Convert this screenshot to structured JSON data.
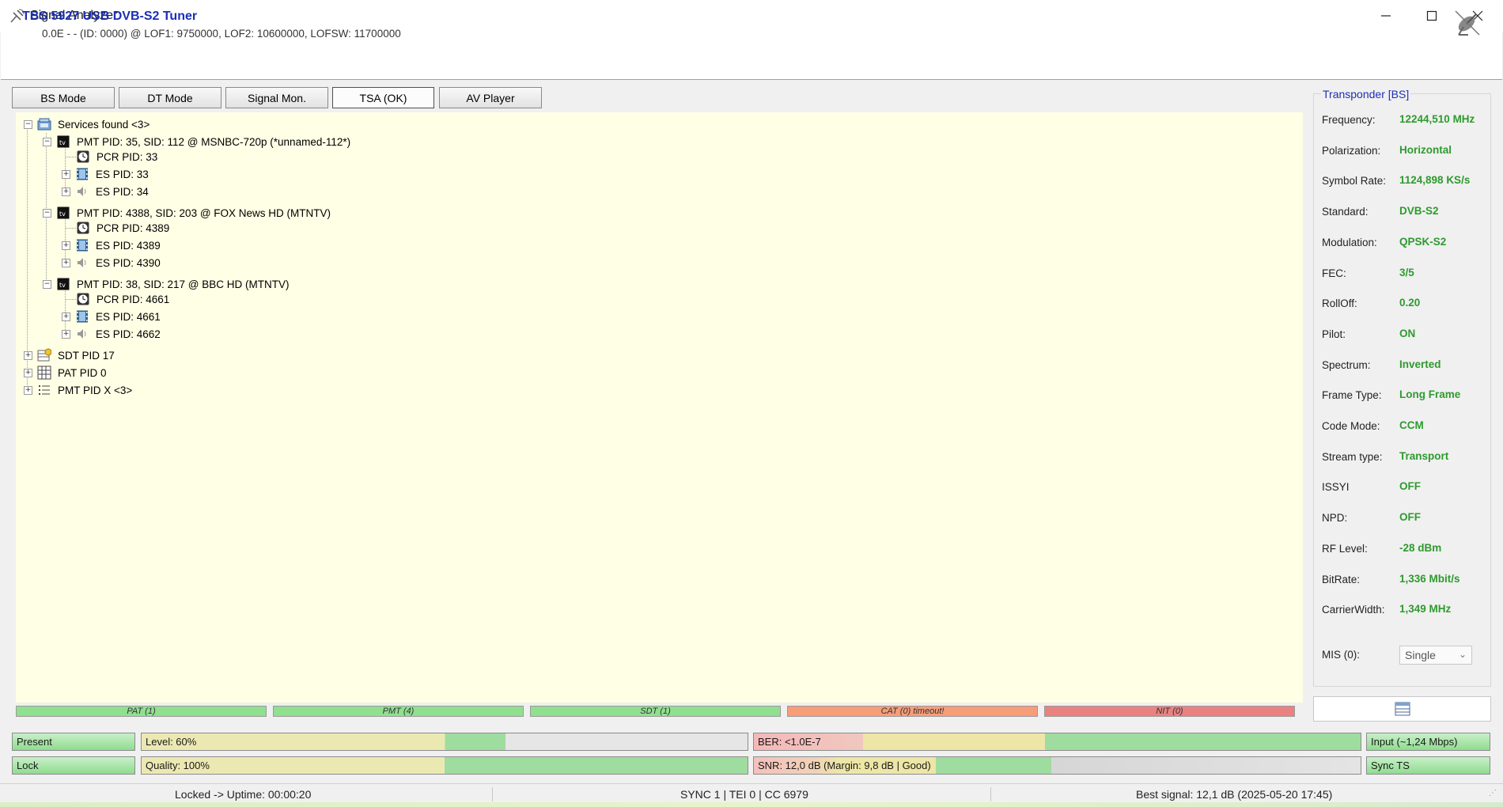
{
  "window": {
    "title": "Signal Analyzer"
  },
  "header": {
    "tuner_name": "TBS 5927 USB DVB-S2 Tuner",
    "tuner_info": "0.0E - - (ID: 0000) @ LOF1: 9750000, LOF2: 10600000, LOFSW: 11700000"
  },
  "tabs": [
    {
      "label": "BS Mode",
      "active": false
    },
    {
      "label": "DT Mode",
      "active": false
    },
    {
      "label": "Signal Mon.",
      "active": false
    },
    {
      "label": "TSA (OK)",
      "active": true
    },
    {
      "label": "AV Player",
      "active": false
    }
  ],
  "tree": {
    "root": "Services found <3>",
    "services": [
      {
        "label": "PMT PID: 35, SID: 112 @ MSNBC-720p (*unnamed-112*)",
        "children": [
          "PCR PID: 33",
          "ES PID: 33",
          "ES PID: 34"
        ]
      },
      {
        "label": "PMT PID: 4388, SID: 203 @ FOX News HD (MTNTV)",
        "children": [
          "PCR PID: 4389",
          "ES PID: 4389",
          "ES PID: 4390"
        ]
      },
      {
        "label": "PMT PID: 38, SID: 217 @ BBC HD (MTNTV)",
        "children": [
          "PCR PID: 4661",
          "ES PID: 4661",
          "ES PID: 4662"
        ]
      }
    ],
    "sdt": "SDT PID 17",
    "pat": "PAT PID 0",
    "pmt": "PMT PID X <3>"
  },
  "table_status": [
    {
      "label": "PAT (1)",
      "color": "#90e090"
    },
    {
      "label": "PMT (4)",
      "color": "#90e090"
    },
    {
      "label": "SDT (1)",
      "color": "#90e090"
    },
    {
      "label": "CAT (0) timeout!",
      "color": "#f79d78"
    },
    {
      "label": "NIT (0)",
      "color": "#ea8282"
    }
  ],
  "transponder": {
    "title": "Transponder [BS]",
    "rows": [
      {
        "label": "Frequency:",
        "value": "12244,510 MHz"
      },
      {
        "label": "Polarization:",
        "value": "Horizontal"
      },
      {
        "label": "Symbol Rate:",
        "value": "1124,898 KS/s"
      },
      {
        "label": "Standard:",
        "value": "DVB-S2"
      },
      {
        "label": "Modulation:",
        "value": "QPSK-S2"
      },
      {
        "label": "FEC:",
        "value": "3/5"
      },
      {
        "label": "RollOff:",
        "value": "0.20"
      },
      {
        "label": "Pilot:",
        "value": "ON"
      },
      {
        "label": "Spectrum:",
        "value": "Inverted"
      },
      {
        "label": "Frame Type:",
        "value": "Long Frame"
      },
      {
        "label": "Code Mode:",
        "value": "CCM"
      },
      {
        "label": "Stream type:",
        "value": "Transport"
      },
      {
        "label": "ISSYI",
        "value": "OFF"
      },
      {
        "label": "NPD:",
        "value": "OFF"
      },
      {
        "label": "RF Level:",
        "value": "-28 dBm"
      },
      {
        "label": "BitRate:",
        "value": "1,336 Mbit/s"
      },
      {
        "label": "CarrierWidth:",
        "value": "1,349 MHz"
      }
    ],
    "mis_label": "MIS (0):",
    "mis_value": "Single"
  },
  "signal": {
    "present": "Present",
    "lock": "Lock",
    "level_text": "Level: 60%",
    "level_fraction": 0.6,
    "quality_text": "Quality: 100%",
    "quality_fraction": 1.0,
    "ber_text": "BER: <1.0E-7",
    "snr_text": "SNR: 12,0 dB (Margin: 9,8 dB | Good)",
    "input_text": "Input (~1,24 Mbps)",
    "sync_text": "Sync TS"
  },
  "statusbar": {
    "uptime": "Locked -> Uptime: 00:00:20",
    "sync": "SYNC 1 | TEI 0 | CC 6979",
    "best_signal": "Best signal: 12,1 dB (2025-05-20 17:45)"
  }
}
